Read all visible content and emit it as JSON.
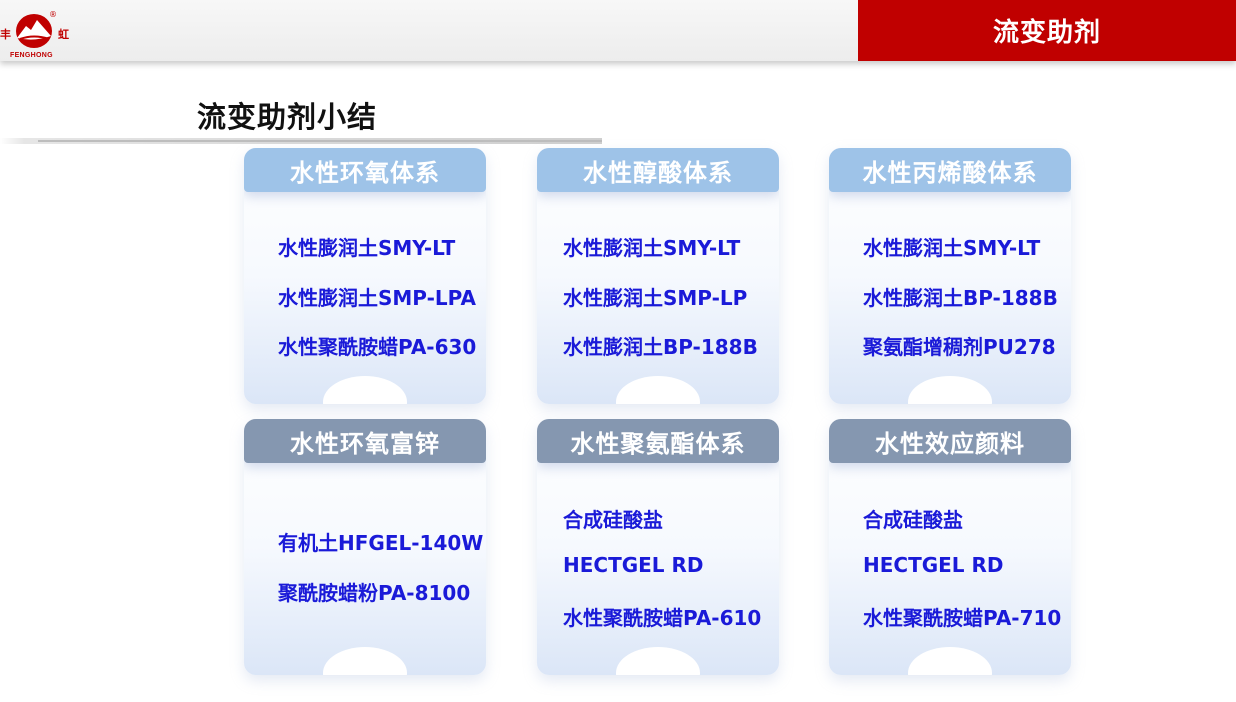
{
  "header": {
    "section_title": "流变助剂",
    "logo": {
      "char_left": "丰",
      "char_right": "虹",
      "text": "FENGHONG",
      "reg": "®"
    }
  },
  "page_title": "流变助剂小结",
  "cards": [
    {
      "title": "水性环氧体系",
      "items": [
        "水性膨润土SMY-LT",
        "水性膨润土SMP-LPA",
        "水性聚酰胺蜡PA-630"
      ]
    },
    {
      "title": "水性醇酸体系",
      "items": [
        "水性膨润土SMY-LT",
        "水性膨润土SMP-LP",
        "水性膨润土BP-188B"
      ]
    },
    {
      "title": "水性丙烯酸体系",
      "items": [
        "水性膨润土SMY-LT",
        "水性膨润土BP-188B",
        "聚氨酯增稠剂PU278"
      ]
    },
    {
      "title": "水性环氧富锌",
      "items": [
        "有机土HFGEL-140W",
        "聚酰胺蜡粉PA-8100"
      ]
    },
    {
      "title": "水性聚氨酯体系",
      "items": [
        "合成硅酸盐",
        "HECTGEL RD",
        "水性聚酰胺蜡PA-610"
      ]
    },
    {
      "title": "水性效应颜料",
      "items": [
        "合成硅酸盐",
        "HECTGEL RD",
        "水性聚酰胺蜡PA-710"
      ]
    }
  ],
  "colors": {
    "brand_red": "#c00000",
    "item_text": "#1a1ad8",
    "top_header": "#9ec3e8",
    "bottom_header": "#8597b0"
  }
}
